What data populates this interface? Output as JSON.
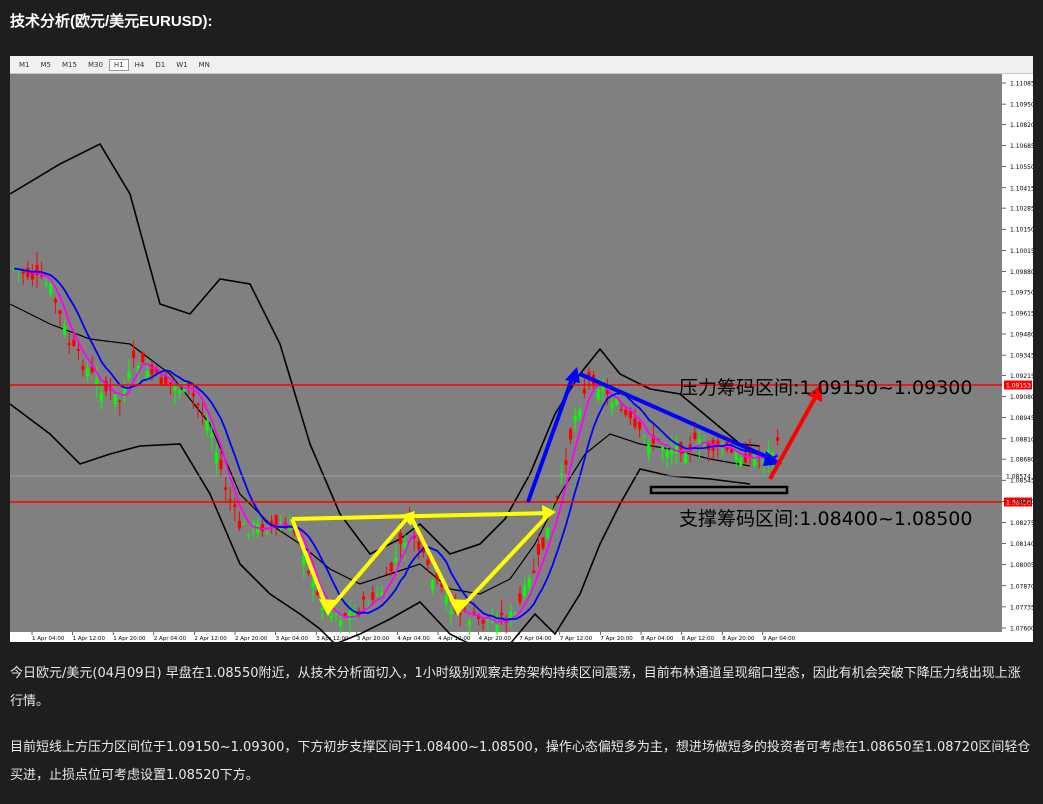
{
  "heading": "技术分析(欧元/美元EURUSD):",
  "chart": {
    "timeframes": [
      "M1",
      "M5",
      "M15",
      "M30",
      "H1",
      "H4",
      "D1",
      "W1",
      "MN"
    ],
    "active_timeframe": "H1",
    "price_ticks": [
      "1.11085",
      "1.10950",
      "1.10820",
      "1.10685",
      "1.10550",
      "1.10415",
      "1.10285",
      "1.10150",
      "1.10015",
      "1.09880",
      "1.09750",
      "1.09615",
      "1.09480",
      "1.09345",
      "1.09215",
      "1.09080",
      "1.08945",
      "1.08810",
      "1.08680",
      "1.08545",
      "1.08410",
      "1.08275",
      "1.08140",
      "1.08005",
      "1.07870",
      "1.07735",
      "1.07600"
    ],
    "time_ticks": [
      "1 Apr 04:00",
      "1 Apr 12:00",
      "1 Apr 20:00",
      "2 Apr 04:00",
      "2 Apr 12:00",
      "2 Apr 20:00",
      "3 Apr 04:00",
      "3 Apr 12:00",
      "3 Apr 20:00",
      "4 Apr 04:00",
      "4 Apr 12:00",
      "4 Apr 20:00",
      "7 Apr 04:00",
      "7 Apr 12:00",
      "7 Apr 20:00",
      "8 Apr 04:00",
      "8 Apr 12:00",
      "8 Apr 20:00",
      "9 Apr 04:00"
    ],
    "resistance_label": "压力筹码区间:1.09150~1.09300",
    "support_label": "支撑筹码区间:1.08400~1.08500",
    "current_price_tag": "1.08574",
    "resistance_tag": "1.09153",
    "support_tag": "1.08450",
    "colors": {
      "background": "#808080",
      "bull_candle": "#00ff00",
      "bear_candle": "#ff0000",
      "bollinger": "#000000",
      "ma_fast": "#ff00ff",
      "ma_slow": "#0000ff",
      "level_line": "#ff0000",
      "yellow_pattern": "#ffff00",
      "blue_arrow": "#0000ff",
      "red_arrow": "#ff0000"
    }
  },
  "paragraph1": "今日欧元/美元(04月09日) 早盘在1.08550附近，从技术分析面切入，1小时级别观察走势架构持续区间震荡，目前布林通道呈现缩口型态，因此有机会突破下降压力线出现上涨行情。",
  "paragraph2": "目前短线上方压力区间位于1.09150~1.09300，下方初步支撑区间于1.08400~1.08500，操作心态偏短多为主，想进场做短多的投资者可考虑在1.08650至1.08720区间轻仓买进，止损点位可考虑设置1.08520下方。"
}
